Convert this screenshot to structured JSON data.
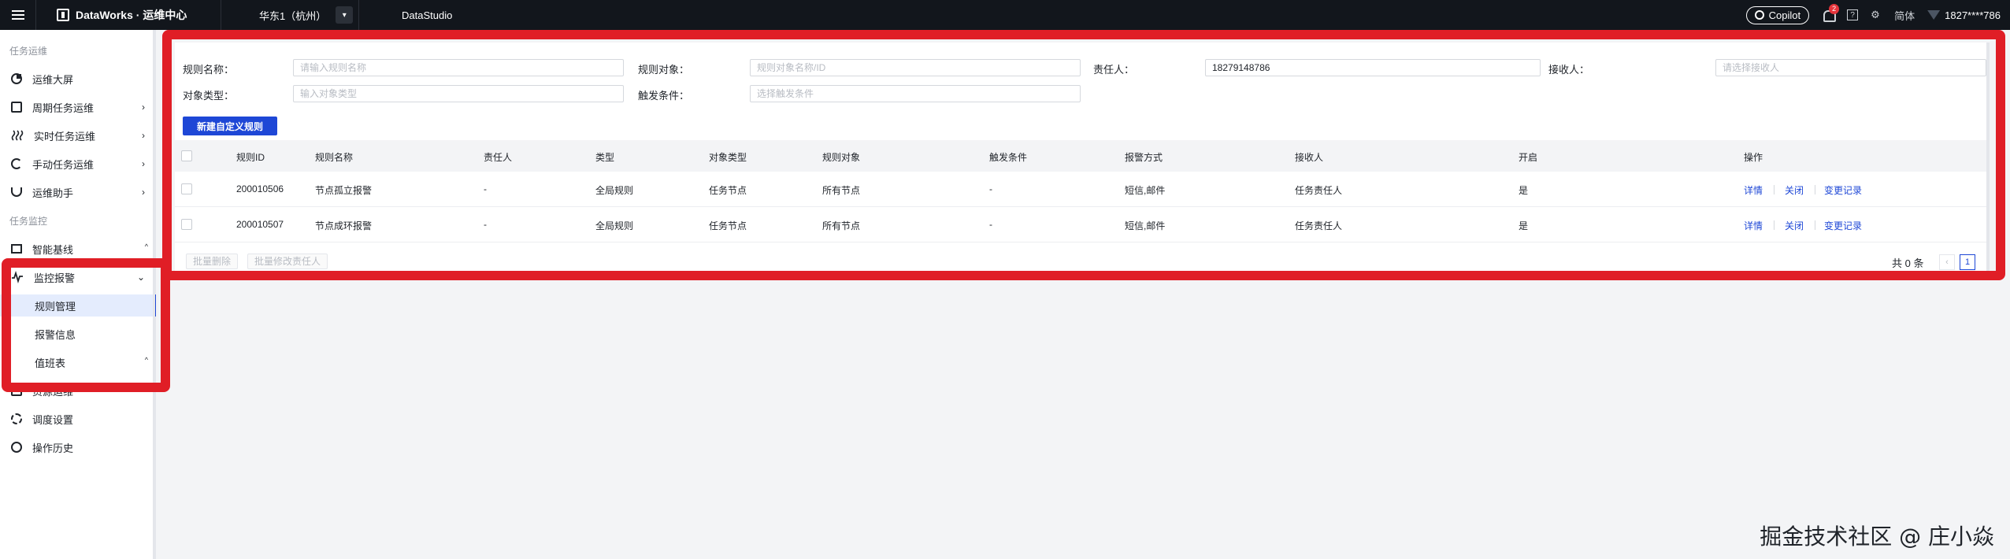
{
  "topbar": {
    "brand": "DataWorks · 运维中心",
    "region": "华东1（杭州）",
    "studio": "DataStudio",
    "copilot": "Copilot",
    "notify_count": "2",
    "help": "?",
    "lang": "简体",
    "user": "1827****786"
  },
  "sidebar": {
    "group1": "任务运维",
    "group2": "任务监控",
    "items": [
      {
        "label": "运维大屏"
      },
      {
        "label": "周期任务运维",
        "arrow": "›"
      },
      {
        "label": "实时任务运维",
        "arrow": "›"
      },
      {
        "label": "手动任务运维",
        "arrow": "›"
      },
      {
        "label": "运维助手",
        "arrow": "›"
      },
      {
        "label": "智能基线",
        "mark": "^"
      },
      {
        "label": "监控报警",
        "arrow": "⌄"
      },
      {
        "label": "规则管理"
      },
      {
        "label": "报警信息"
      },
      {
        "label": "值班表",
        "mark": "^"
      },
      {
        "label": "资源运维"
      },
      {
        "label": "调度设置"
      },
      {
        "label": "操作历史"
      }
    ]
  },
  "filters": {
    "rule_name_label": "规则名称：",
    "rule_name_ph": "请输入规则名称",
    "rule_target_label": "规则对象：",
    "rule_target_ph": "规则对象名称/ID",
    "owner_label": "责任人：",
    "owner_value": "18279148786",
    "receiver_label": "接收人：",
    "receiver_ph": "请选择接收人",
    "obj_type_label": "对象类型：",
    "obj_type_ph": "输入对象类型",
    "trigger_label": "触发条件：",
    "trigger_ph": "选择触发条件"
  },
  "new_rule_button": "新建自定义规则",
  "table": {
    "headers": [
      "规则ID",
      "规则名称",
      "责任人",
      "类型",
      "对象类型",
      "规则对象",
      "触发条件",
      "报警方式",
      "接收人",
      "开启",
      "操作"
    ],
    "rows": [
      {
        "id": "200010506",
        "name": "节点孤立报警",
        "owner": "-",
        "type": "全局规则",
        "obj_type": "任务节点",
        "target": "所有节点",
        "trigger": "-",
        "alert": "短信,邮件",
        "receiver": "任务责任人",
        "enabled": "是"
      },
      {
        "id": "200010507",
        "name": "节点成环报警",
        "owner": "-",
        "type": "全局规则",
        "obj_type": "任务节点",
        "target": "所有节点",
        "trigger": "-",
        "alert": "短信,邮件",
        "receiver": "任务责任人",
        "enabled": "是"
      }
    ],
    "actions": [
      "详情",
      "关闭",
      "变更记录"
    ]
  },
  "footer": {
    "batch_delete": "批量删除",
    "batch_owner": "批量修改责任人",
    "total": "共 0 条",
    "prev": "‹",
    "page": "1"
  },
  "watermark": "掘金技术社区 @ 庄小焱",
  "colors": {
    "accent": "#1e47d6",
    "highlight": "#e01e26",
    "topbar": "#12161c"
  }
}
